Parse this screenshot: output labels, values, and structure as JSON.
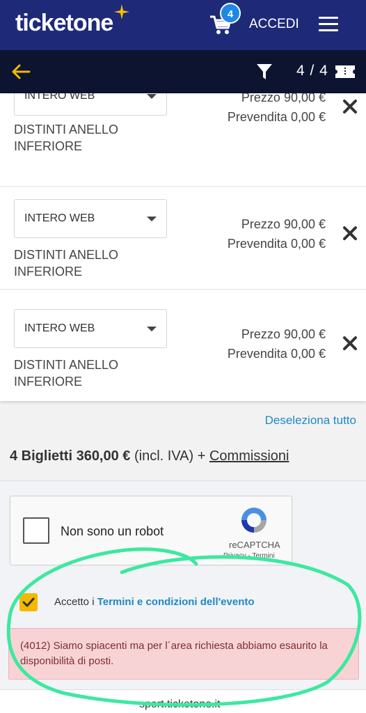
{
  "header": {
    "logo": "ticketone",
    "cart_count": "4",
    "login_label": "ACCEDI",
    "icons": {
      "cart": "cart-icon",
      "menu": "hamburger-menu-icon",
      "star": "logo-star-icon"
    },
    "colors": {
      "brand": "#1e2a78",
      "badge": "#1e88e5",
      "star": "#f5c000"
    }
  },
  "navbar": {
    "counter": "4 / 4",
    "icons": {
      "back": "back-arrow-icon",
      "filter": "filter-icon",
      "ticket": "ticket-icon"
    },
    "colors": {
      "background": "#0c1430",
      "back_arrow": "#f5b800"
    }
  },
  "tickets": [
    {
      "type": "INTERO WEB",
      "sector": "DISTINTI ANELLO INFERIORE",
      "price": "Prezzo 90,00 €",
      "presale": "Prevendita 0,00 €"
    },
    {
      "type": "INTERO WEB",
      "sector": "DISTINTI ANELLO INFERIORE",
      "price": "Prezzo 90,00 €",
      "presale": "Prevendita 0,00 €"
    },
    {
      "type": "INTERO WEB",
      "sector": "DISTINTI ANELLO INFERIORE",
      "price": "Prezzo 90,00 €",
      "presale": "Prevendita 0,00 €"
    }
  ],
  "summary": {
    "deselect_all": "Deseleziona tutto",
    "total": "4 Biglietti 360,00 €",
    "vat": "(incl. IVA) +",
    "commissions": "Commissioni"
  },
  "recaptcha": {
    "label": "Non sono un robot",
    "brand": "reCAPTCHA",
    "links": "Privacy - Termini"
  },
  "terms": {
    "prefix": "Accetto i",
    "link": "Termini e condizioni dell'evento",
    "checked": true,
    "check_color": "#f5b800"
  },
  "error": {
    "message": "(4012) Siamo spiacenti ma per l´area richiesta abbiamo esaurito la disponibilità di posti."
  },
  "footer": {
    "text": "sport.ticketone.it"
  },
  "annotation": {
    "color": "#3de8a0"
  }
}
